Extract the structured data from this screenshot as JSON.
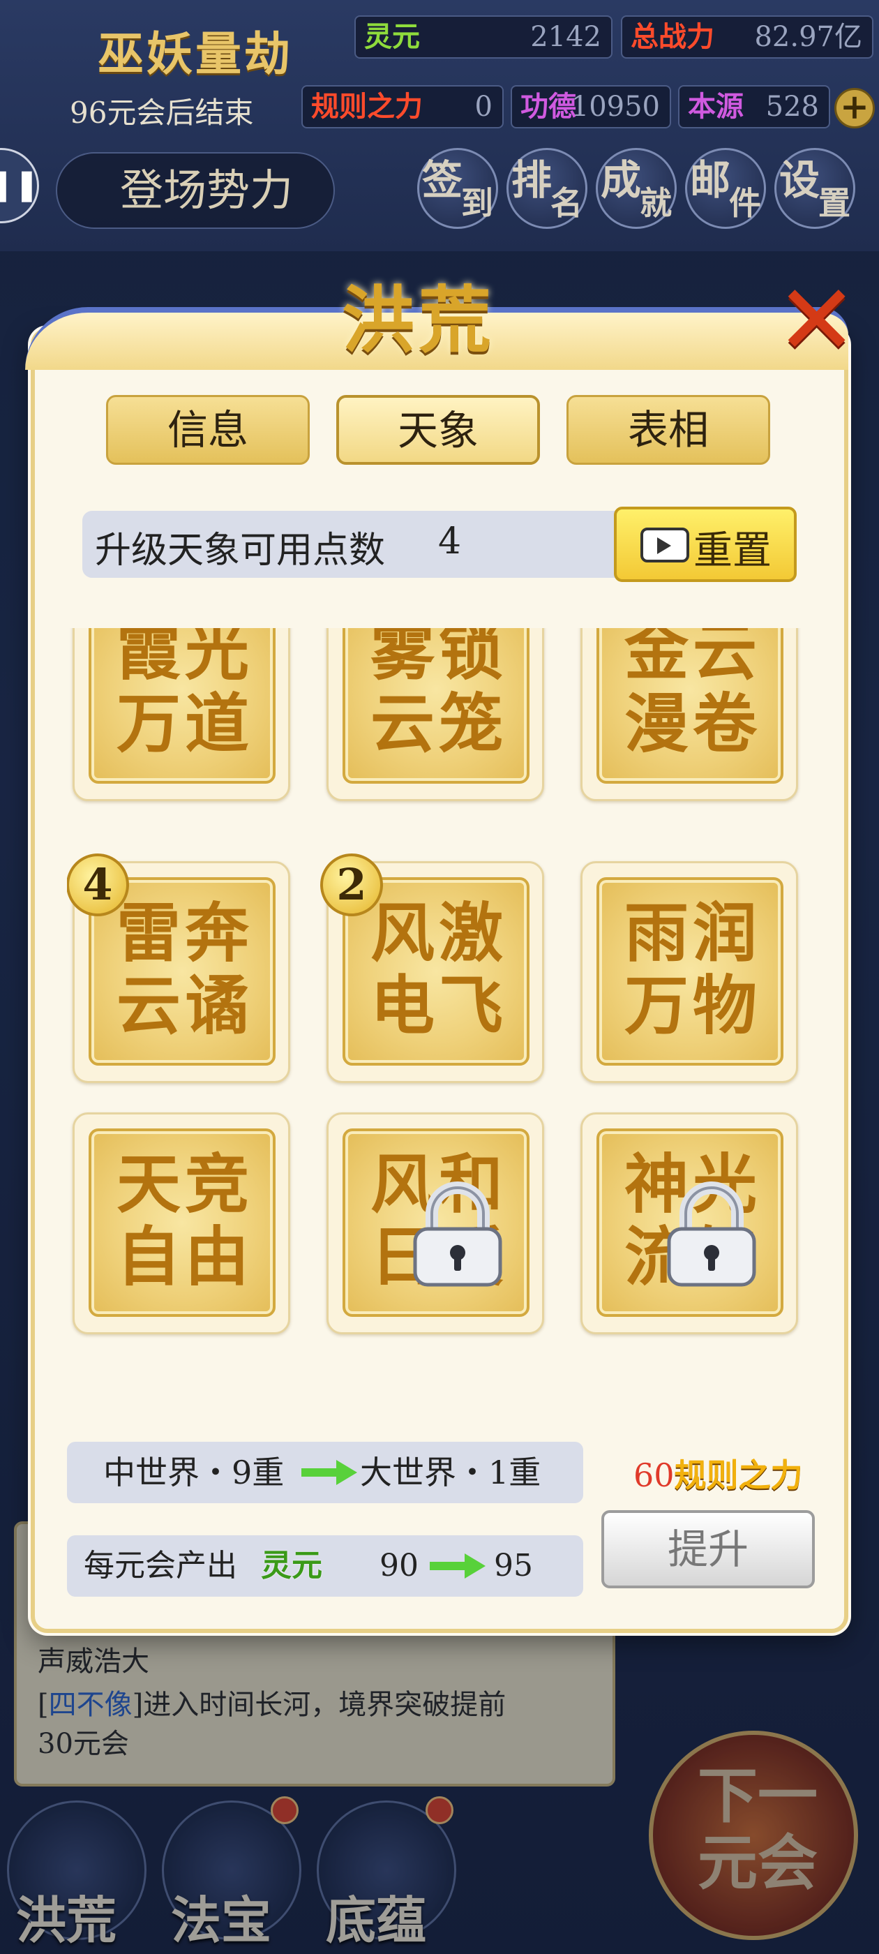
{
  "background": {
    "game_title": "巫妖量劫",
    "era_countdown": "96元会后结束",
    "stats": {
      "lingyuan": {
        "label": "灵元",
        "value": "2142"
      },
      "total_power": {
        "label": "总战力",
        "value": "82.97亿"
      },
      "rule_power": {
        "label": "规则之力",
        "value": "0"
      },
      "merit": {
        "label": "功德",
        "value": "10950"
      },
      "origin": {
        "label": "本源",
        "value": "528"
      }
    },
    "faction_button": "登场势力",
    "menu": [
      {
        "t1": "签",
        "t2": "到"
      },
      {
        "t1": "排",
        "t2": "名"
      },
      {
        "t1": "成",
        "t2": "就"
      },
      {
        "t1": "邮",
        "t2": "件"
      },
      {
        "t1": "设",
        "t2": "置"
      }
    ],
    "info_line1": "声威浩大",
    "info_tag": "四不像",
    "info_line2": "进入时间长河，境界突破提前",
    "info_line3": "30元会",
    "nav": [
      "洪荒",
      "法宝",
      "底蕴"
    ],
    "next_button": "下一元会"
  },
  "modal": {
    "title": "洪荒",
    "close_icon": "close-x",
    "tabs": [
      {
        "label": "信息",
        "active": false
      },
      {
        "label": "天象",
        "active": true
      },
      {
        "label": "表相",
        "active": false
      }
    ],
    "points": {
      "label": "升级天象可用点数",
      "value": "4"
    },
    "reset_button": "重置",
    "tiles": [
      {
        "line1": "霞光",
        "line2": "万道",
        "badge": "",
        "locked": false
      },
      {
        "line1": "雾锁",
        "line2": "云笼",
        "badge": "",
        "locked": false
      },
      {
        "line1": "金云",
        "line2": "漫卷",
        "badge": "",
        "locked": false
      },
      {
        "line1": "雷奔",
        "line2": "云谲",
        "badge": "4",
        "locked": false
      },
      {
        "line1": "风激",
        "line2": "电飞",
        "badge": "2",
        "locked": false
      },
      {
        "line1": "雨润",
        "line2": "万物",
        "badge": "",
        "locked": false
      },
      {
        "line1": "天竞",
        "line2": "自由",
        "badge": "",
        "locked": false
      },
      {
        "line1": "风和",
        "line2": "日暖",
        "badge": "",
        "locked": true
      },
      {
        "line1": "神光",
        "line2": "流转",
        "badge": "",
        "locked": true
      }
    ],
    "world": {
      "from": "中世界・9重",
      "to": "大世界・1重"
    },
    "rule_cost": {
      "amount": "60",
      "label": "规则之力"
    },
    "output": {
      "prefix": "每元会产出",
      "resource": "灵元",
      "from": "90",
      "to": "95"
    },
    "upgrade_button": "提升",
    "colors": {
      "accent": "#d9a52a",
      "arrow": "#58d13a",
      "close": "#d43a16"
    }
  }
}
